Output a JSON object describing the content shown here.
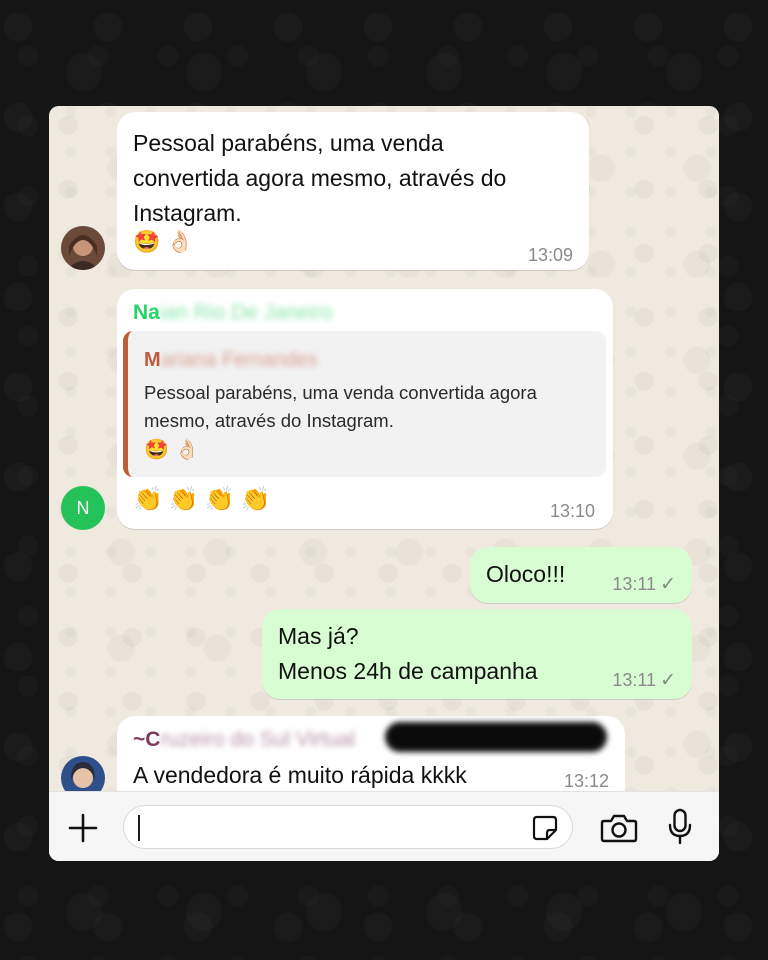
{
  "messages": {
    "m1": {
      "text_line1": "Pessoal parabéns, uma venda",
      "text_line2": "convertida agora mesmo, através do",
      "text_line3": "Instagram.",
      "emoji": "🤩👌🏻",
      "time": "13:09"
    },
    "m2": {
      "sender_visible": "Na",
      "sender_blurred": "ian Rio De Janeiro",
      "quote_sender_visible": "M",
      "quote_sender_blurred": "ariana Fernandes",
      "quote_line1": "Pessoal parabéns, uma venda convertida agora",
      "quote_line2": "mesmo, através do Instagram.",
      "quote_emoji": "🤩👌🏻",
      "text_emoji": "👏👏👏👏",
      "time": "13:10",
      "avatar_initial": "N"
    },
    "m3": {
      "text": "Oloco!!!",
      "time": "13:11",
      "ticks": "✓"
    },
    "m4": {
      "text_line1": "Mas já?",
      "text_line2": "Menos 24h de campanha",
      "time": "13:11",
      "ticks": "✓"
    },
    "m5": {
      "sender_visible": "~C",
      "sender_blurred": "ruzeiro do Sul Virtual",
      "text": "A vendedora é muito rápida kkkk",
      "time": "13:12"
    }
  },
  "colors": {
    "incoming_bubble": "#ffffff",
    "outgoing_bubble": "#d9fdd3",
    "sender_green": "#25d366",
    "quote_accent": "#c05a3d",
    "sender_purple": "#7b3a5e",
    "avatar_n": "#25c25a"
  },
  "icons": [
    "plus-icon",
    "sticker-icon",
    "camera-icon",
    "microphone-icon"
  ]
}
